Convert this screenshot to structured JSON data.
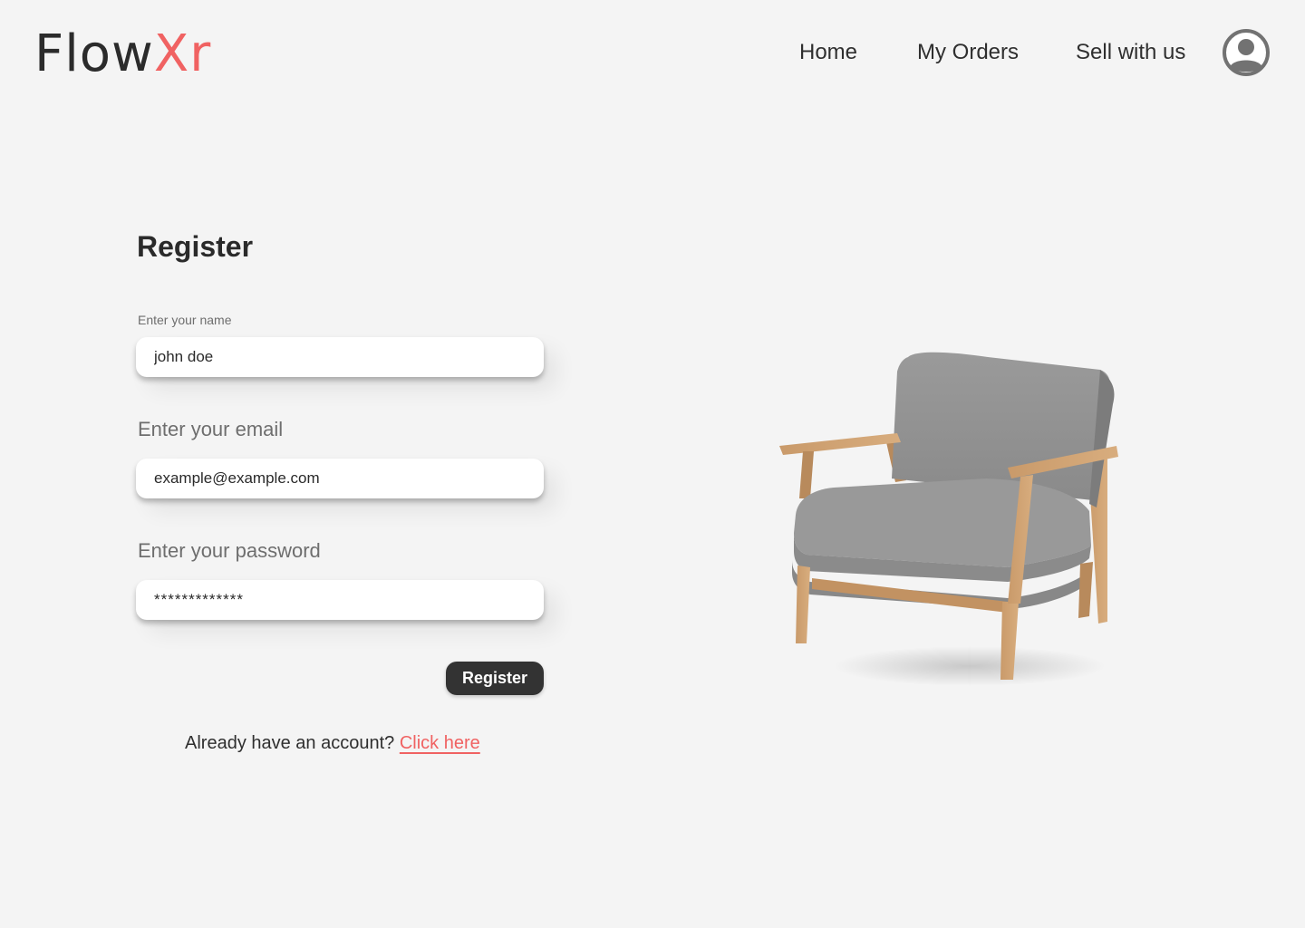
{
  "header": {
    "logo": {
      "part1": "Flow",
      "part2": "Xr"
    },
    "nav": [
      {
        "label": "Home"
      },
      {
        "label": "My Orders"
      },
      {
        "label": "Sell with us"
      }
    ]
  },
  "form": {
    "title": "Register",
    "name_label": "Enter your name",
    "name_value": "john doe",
    "email_label": "Enter your email",
    "email_value": "example@example.com",
    "password_label": "Enter your password",
    "password_value": "*************",
    "submit_label": "Register"
  },
  "footer": {
    "prompt": "Already have an account?",
    "link": "Click here"
  },
  "colors": {
    "accent": "#f06262",
    "background": "#f4f4f4",
    "button": "#333333",
    "text": "#2f2f2f"
  },
  "icons": {
    "avatar": "user-avatar-icon",
    "product": "armchair-image"
  }
}
